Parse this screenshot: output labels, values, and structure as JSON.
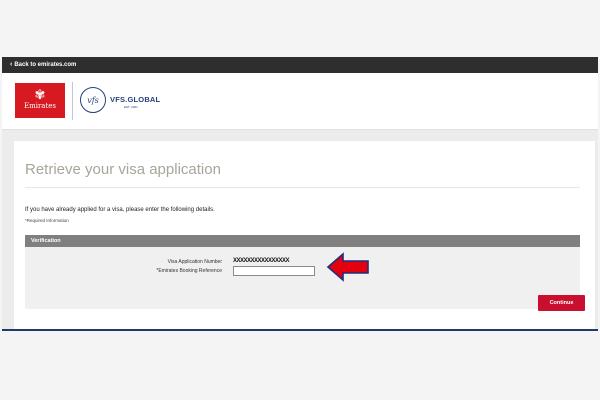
{
  "topbar": {
    "back_icon": "chevron-left-icon",
    "back_label": "Back to emirates.com"
  },
  "brand": {
    "emirates_logo_text": "Emirates",
    "vfs_emblem_text": "vfs",
    "vfs_name": "VFS.GLOBAL",
    "vfs_est": "EST. 2001",
    "emirates_red": "#d71921",
    "vfs_blue": "#25407b"
  },
  "page": {
    "title": "Retrieve your visa application",
    "intro": "If you have already applied for a visa, please enter the following details.",
    "required_note": "*Required Information"
  },
  "verification": {
    "section_title": "Verification",
    "app_number_label": "Visa Application Number",
    "app_number_value": "XXXXXXXXXXXXXXXX",
    "booking_ref_label": "*Emirates Booking Reference",
    "booking_ref_value": "",
    "arrow_icon": "red-arrow-left-icon"
  },
  "actions": {
    "continue_label": "Continue",
    "accent": "#c8102e"
  }
}
